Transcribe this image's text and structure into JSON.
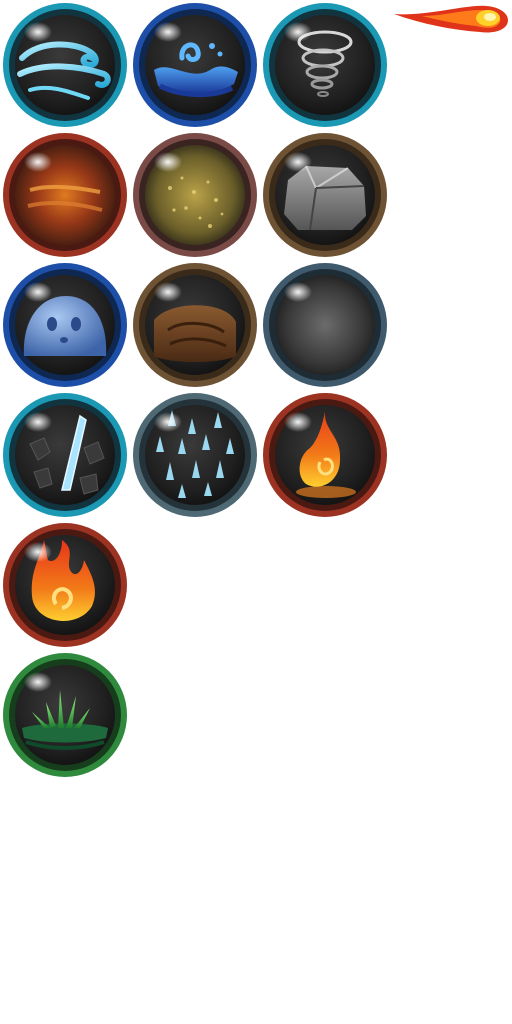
{
  "sheet": {
    "icons": [
      {
        "id": "wind",
        "ring": "#1a98b4"
      },
      {
        "id": "water",
        "ring": "#1e4fa8"
      },
      {
        "id": "tornado",
        "ring": "#1a98b4"
      },
      {
        "id": "fire-cloud",
        "ring": "#9c3322"
      },
      {
        "id": "sand",
        "ring": "#7a4a46"
      },
      {
        "id": "rock",
        "ring": "#6e5234"
      },
      {
        "id": "slime",
        "ring": "#1e4fa8"
      },
      {
        "id": "mud",
        "ring": "#6e5234"
      },
      {
        "id": "smoke",
        "ring": "#3f5a6c"
      },
      {
        "id": "ice-shard",
        "ring": "#1a98b4"
      },
      {
        "id": "ice-spikes",
        "ring": "#4e6874"
      },
      {
        "id": "flame",
        "ring": "#9c3322"
      },
      {
        "id": "inferno",
        "ring": "#9c3322"
      },
      {
        "id": "grass",
        "ring": "#2f8a3e"
      }
    ],
    "projectile": {
      "id": "fireball",
      "colors": [
        "#ffd02a",
        "#ff7a18",
        "#e0341a"
      ]
    }
  }
}
